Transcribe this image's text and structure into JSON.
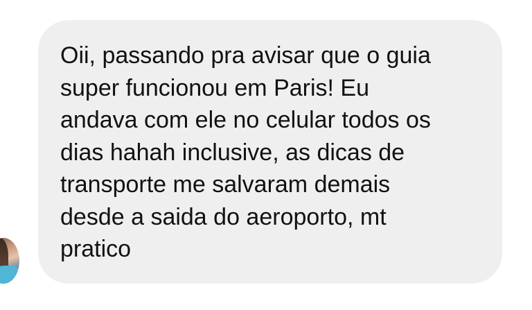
{
  "conversation": {
    "message": {
      "text": "Oii, passando pra avisar que o guia\nsuper funcionou em Paris! Eu\nandava com ele no celular todos os\ndias hahah inclusive, as dicas de\ntransporte me salvaram demais\ndesde a saida do aeroporto, mt\npratico"
    },
    "sender": {
      "avatar_icon": "profile-avatar"
    }
  },
  "colors": {
    "bubble_background": "#efefef",
    "text": "#111111",
    "page_background": "#ffffff"
  }
}
